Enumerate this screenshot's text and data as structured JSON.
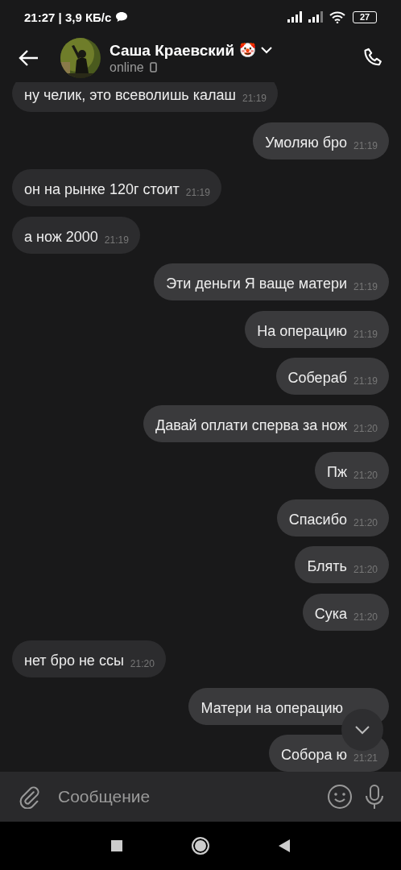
{
  "status_bar": {
    "time": "21:27 | 3,9 КБ/с",
    "battery": "27"
  },
  "header": {
    "name": "Саша Краевский",
    "emoji": "🤡",
    "presence": "online"
  },
  "messages": [
    {
      "outgoing": false,
      "text": "ну челик, это всеволишь калаш",
      "time": "21:19"
    },
    {
      "outgoing": true,
      "text": "Умоляю бро",
      "time": "21:19"
    },
    {
      "outgoing": false,
      "text": "он на рынке 120г стоит",
      "time": "21:19"
    },
    {
      "outgoing": false,
      "text": "а нож 2000",
      "time": "21:19"
    },
    {
      "outgoing": true,
      "text": "Эти деньги Я ваще матери",
      "time": "21:19"
    },
    {
      "outgoing": true,
      "text": "На операцию",
      "time": "21:19"
    },
    {
      "outgoing": true,
      "text": "Собераб",
      "time": "21:19"
    },
    {
      "outgoing": true,
      "text": "Давай оплати сперва за нож",
      "time": "21:20"
    },
    {
      "outgoing": true,
      "text": "Пж",
      "time": "21:20"
    },
    {
      "outgoing": true,
      "text": "Спасибо",
      "time": "21:20"
    },
    {
      "outgoing": true,
      "text": "Блять",
      "time": "21:20"
    },
    {
      "outgoing": true,
      "text": "Сука",
      "time": "21:20"
    },
    {
      "outgoing": false,
      "text": "нет бро не ссы",
      "time": "21:20"
    },
    {
      "outgoing": true,
      "text": "Матери на операцию"
    },
    {
      "outgoing": true,
      "text": "Собора ю",
      "time": "21:21"
    }
  ],
  "composer": {
    "placeholder": "Сообщение"
  }
}
